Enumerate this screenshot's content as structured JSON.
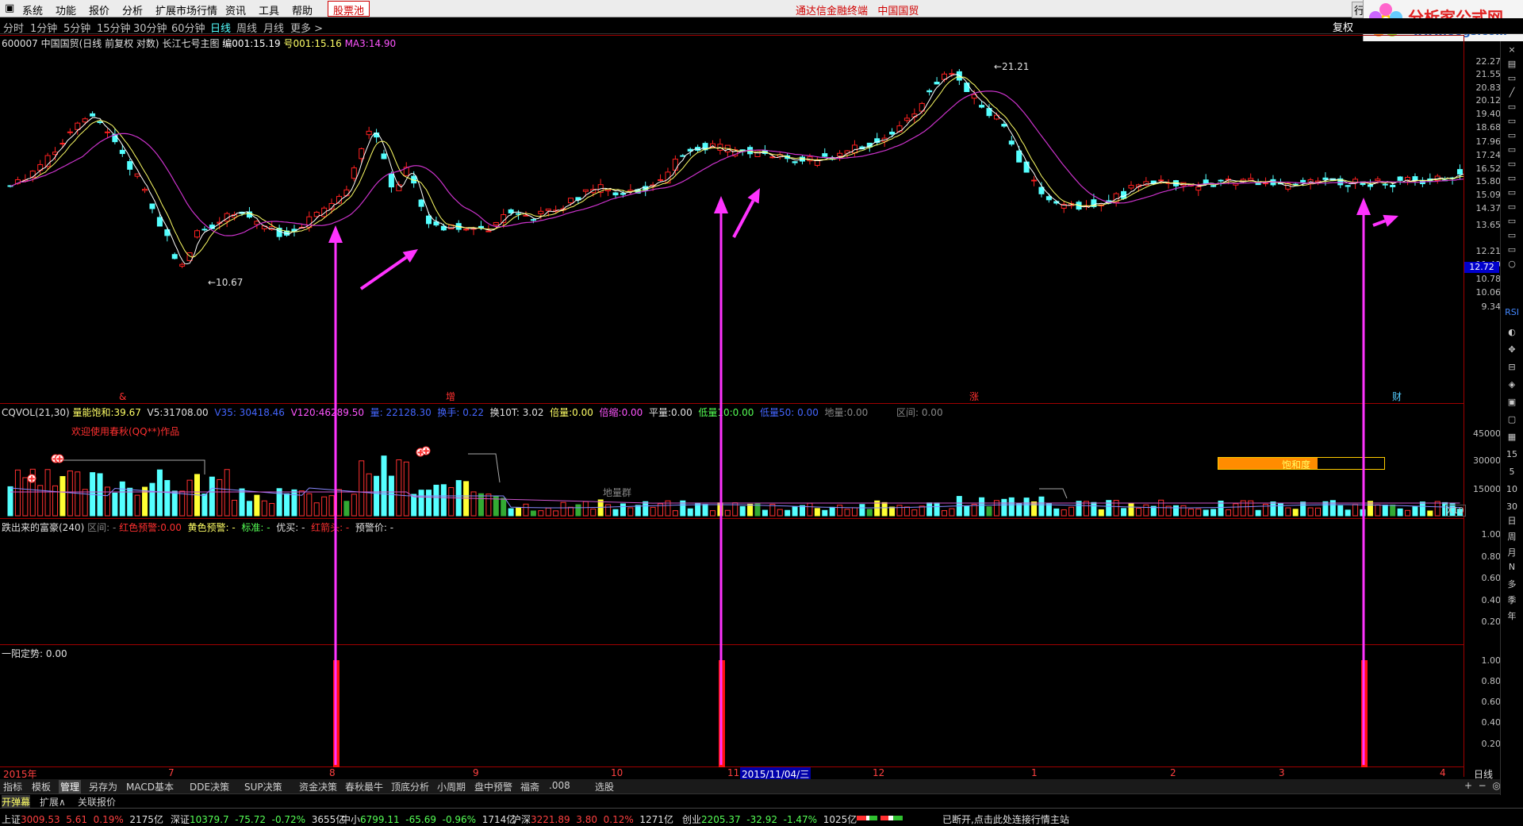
{
  "menu": {
    "items": [
      "系统",
      "功能",
      "报价",
      "分析",
      "扩展市场行情",
      "资讯",
      "工具",
      "帮助"
    ],
    "stock_button": "股票池",
    "center_title": "通达信金融终端",
    "center_stock": "中国国贸"
  },
  "logo": {
    "title": "分析家公式网",
    "url": "www.88gs.com"
  },
  "periods": {
    "items": [
      "分时",
      "1分钟",
      "5分钟",
      "15分钟",
      "30分钟",
      "60分钟",
      "日线",
      "周线",
      "月线",
      "更多 >"
    ],
    "active_index": 6
  },
  "fuquan": "复权",
  "main_header": {
    "code_name": "600007 中国国贸(日线 前复权 对数)",
    "formula": "长江七号主图",
    "v1_label": "编001:",
    "v1_value": "15.19",
    "v2_label": "号001:",
    "v2_value": "15.16",
    "v3_label": "MA3:",
    "v3_value": "14.90"
  },
  "main_y_ticks": [
    "22.27",
    "21.55",
    "20.83",
    "20.12",
    "19.40",
    "18.68",
    "17.96",
    "17.24",
    "16.52",
    "15.80",
    "15.09",
    "14.37",
    "13.65",
    "12.21",
    "11.49",
    "10.78",
    "10.06",
    "9.34"
  ],
  "current_price_tag": "12.72",
  "annotations": {
    "high": "21.21",
    "low": "10.67"
  },
  "event_marks": [
    "&",
    "增",
    "涨",
    "财"
  ],
  "vol_header": {
    "name": "CQVOL(21,30)",
    "sat_label": "量能饱和:",
    "sat_value": "39.67",
    "v5_label": "V5:",
    "v5_value": "31708.00",
    "v35": "V35: 30418.46",
    "v120_label": "V120:",
    "v120_value": "46289.50",
    "liang": "量: 22128.30",
    "huanshou": "换手: 0.22",
    "h10t": "换10T: 3.02",
    "beiliang_label": "倍量:",
    "beiliang_value": "0.00",
    "beisuo_label": "倍缩:",
    "beisuo_value": "0.00",
    "pingliang_label": "平量:",
    "pingliang_value": "0.00",
    "diliang10_label": "低量10:",
    "diliang10_value": "0.00",
    "diliang50": "低量50: 0.00",
    "diliang_label": "地量:",
    "diliang_value": "0.00",
    "qujian": "区间: 0.00"
  },
  "vol_y_ticks": [
    "45000",
    "30000",
    "15000"
  ],
  "vol_unit": "X10",
  "vol_welcome": "欢迎使用春秋(QQ**)作品",
  "vol_diliang_text": "地量群",
  "vol_saturation_label": "饱和度",
  "vol_saturation_fraction": 0.6,
  "p3_header": {
    "name": "跌出来的富豪(240)",
    "qujian": "区间: -",
    "red_label": "红色预警:",
    "red_value": "0.00",
    "yellow": "黄色预警: -",
    "standard": "标准: -",
    "youmai": "优买: -",
    "red_arrow": "红箭头: -",
    "jingjia": "预警价: -"
  },
  "p3_y_ticks": [
    "1.00",
    "0.80",
    "0.60",
    "0.40",
    "0.20"
  ],
  "p4_header": {
    "label": "一阳定势:",
    "value": "0.00"
  },
  "p4_y_ticks": [
    "1.00",
    "0.80",
    "0.60",
    "0.40",
    "0.20"
  ],
  "date_axis": {
    "labels": [
      "2015年",
      "7",
      "8",
      "9",
      "10",
      "11",
      "12",
      "1",
      "2",
      "3",
      "4"
    ],
    "cursor_date": "2015/11/04/三",
    "period": "日线"
  },
  "tabs1": [
    "指标",
    "模板",
    "管理",
    "另存为",
    "MACD基本",
    "DDE决策",
    "SUP决策",
    "资金决策",
    "春秋最牛",
    "顶底分析",
    "小周期",
    "盘中预警",
    "福斋",
    ".008",
    "选股"
  ],
  "tabs1_active": 2,
  "tabs2": [
    "开弹幕",
    "扩展∧",
    "关联报价"
  ],
  "status": {
    "sh": {
      "name": "上证",
      "price": "3009.53",
      "chg": "5.61",
      "pct": "0.19%",
      "amt": "2175亿"
    },
    "sz": {
      "name": "深证",
      "price": "10379.7",
      "chg": "-75.72",
      "pct": "-0.72%",
      "amt": "3655亿"
    },
    "zx": {
      "name": "中小",
      "price": "6799.11",
      "chg": "-65.69",
      "pct": "-0.96%",
      "amt": "1714亿"
    },
    "hs": {
      "name": "沪深",
      "price": "3221.89",
      "chg": "3.80",
      "pct": "0.12%",
      "amt": "1271亿"
    },
    "cy": {
      "name": "创业",
      "price": "2205.37",
      "chg": "-32.92",
      "pct": "-1.47%",
      "amt": "1025亿"
    },
    "message": "已断开,点击此处连接行情主站"
  },
  "side_icons": [
    "RSI",
    "日",
    "周",
    "月",
    "N",
    "多",
    "季",
    "年"
  ],
  "colors": {
    "up": "#ff2020",
    "down": "#55ffff",
    "ma_yellow": "#ffff66",
    "ma_purple": "#cc33cc",
    "arrow": "#ff33ff",
    "grid": "#a00000"
  }
}
